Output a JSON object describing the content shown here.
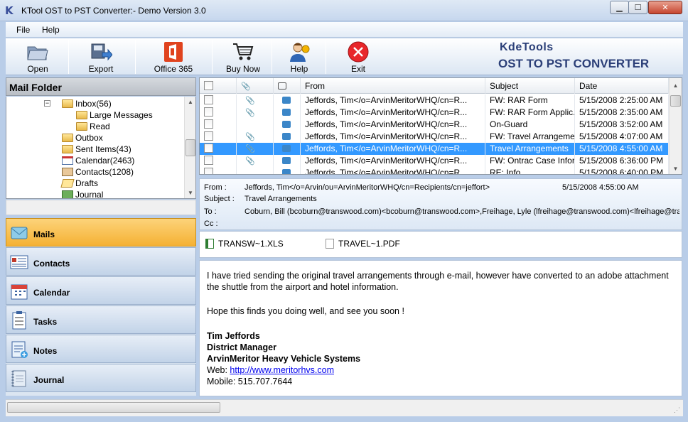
{
  "window": {
    "title": "KTool OST to PST Converter:- Demo Version 3.0",
    "min_symbol": "▁",
    "max_symbol": "☐",
    "close_symbol": "✕"
  },
  "menu": {
    "file": "File",
    "help": "Help"
  },
  "toolbar": {
    "open": "Open",
    "export": "Export",
    "office365": "Office 365",
    "buy_now": "Buy Now",
    "help": "Help",
    "exit": "Exit"
  },
  "brand": {
    "line1": "KdeTools",
    "line2": "OST TO PST CONVERTER"
  },
  "mail_folder": {
    "header": "Mail Folder",
    "items": [
      "Inbox(56)",
      "Large Messages",
      "Read",
      "Outbox",
      "Sent Items(43)",
      "Calendar(2463)",
      "Contacts(1208)",
      "Drafts",
      "Journal"
    ]
  },
  "nav": [
    "Mails",
    "Contacts",
    "Calendar",
    "Tasks",
    "Notes",
    "Journal"
  ],
  "grid": {
    "columns": {
      "from": "From",
      "subject": "Subject",
      "date": "Date"
    },
    "rows": [
      {
        "attach": true,
        "from": "Jeffords, Tim</o=ArvinMeritorWHQ/cn=R...",
        "subject": "FW: RAR Form",
        "date": "5/15/2008 2:25:00 AM"
      },
      {
        "attach": true,
        "from": "Jeffords, Tim</o=ArvinMeritorWHQ/cn=R...",
        "subject": "FW: RAR Form Applic...",
        "date": "5/15/2008 2:35:00 AM"
      },
      {
        "attach": false,
        "from": "Jeffords, Tim</o=ArvinMeritorWHQ/cn=R...",
        "subject": "On-Guard",
        "date": "5/15/2008 3:52:00 AM"
      },
      {
        "attach": true,
        "from": "Jeffords, Tim</o=ArvinMeritorWHQ/cn=R...",
        "subject": "FW: Travel Arrangeme...",
        "date": "5/15/2008 4:07:00 AM"
      },
      {
        "attach": true,
        "from": "Jeffords, Tim</o=ArvinMeritorWHQ/cn=R...",
        "subject": "Travel Arrangements",
        "date": "5/15/2008 4:55:00 AM",
        "selected": true
      },
      {
        "attach": true,
        "from": "Jeffords, Tim</o=ArvinMeritorWHQ/cn=R...",
        "subject": "FW: Ontrac Case Infor...",
        "date": "5/15/2008 6:36:00 PM"
      },
      {
        "attach": false,
        "from": "Jeffords, Tim</o=ArvinMeritorWHQ/cn=R...",
        "subject": "RE: Info",
        "date": "5/15/2008 6:40:00 PM"
      }
    ]
  },
  "preview": {
    "from_label": "From :",
    "from_value": "Jeffords, Tim</o=Arvin/ou=ArvinMeritorWHQ/cn=Recipients/cn=jeffort>",
    "date_value": "5/15/2008 4:55:00 AM",
    "subject_label": "Subject :",
    "subject_value": "Travel Arrangements",
    "to_label": "To :",
    "to_value": "Coburn, Bill (bcoburn@transwood.com)<bcoburn@transwood.com>,Freihage, Lyle (lfreihage@transwood.com)<lfreihage@transwo",
    "cc_label": "Cc :",
    "attachments": [
      "TRANSW~1.XLS",
      "TRAVEL~1.PDF"
    ]
  },
  "body": {
    "line1": "I have tried sending the original travel arrangements through e-mail, however have converted to an adobe attachment",
    "line2": "the shuttle from the airport and hotel information.",
    "line3": "Hope this finds you doing well, and see you soon !",
    "sig_name": "Tim Jeffords",
    "sig_title": "District Manager",
    "sig_company": "ArvinMeritor Heavy Vehicle Systems",
    "web_label": "Web: ",
    "web_link": "http://www.meritorhvs.com",
    "mobile": "Mobile: 515.707.7644"
  },
  "colors": {
    "accent": "#2b3f78",
    "selected_row": "#3399ff",
    "active_nav": "#f5b133"
  }
}
